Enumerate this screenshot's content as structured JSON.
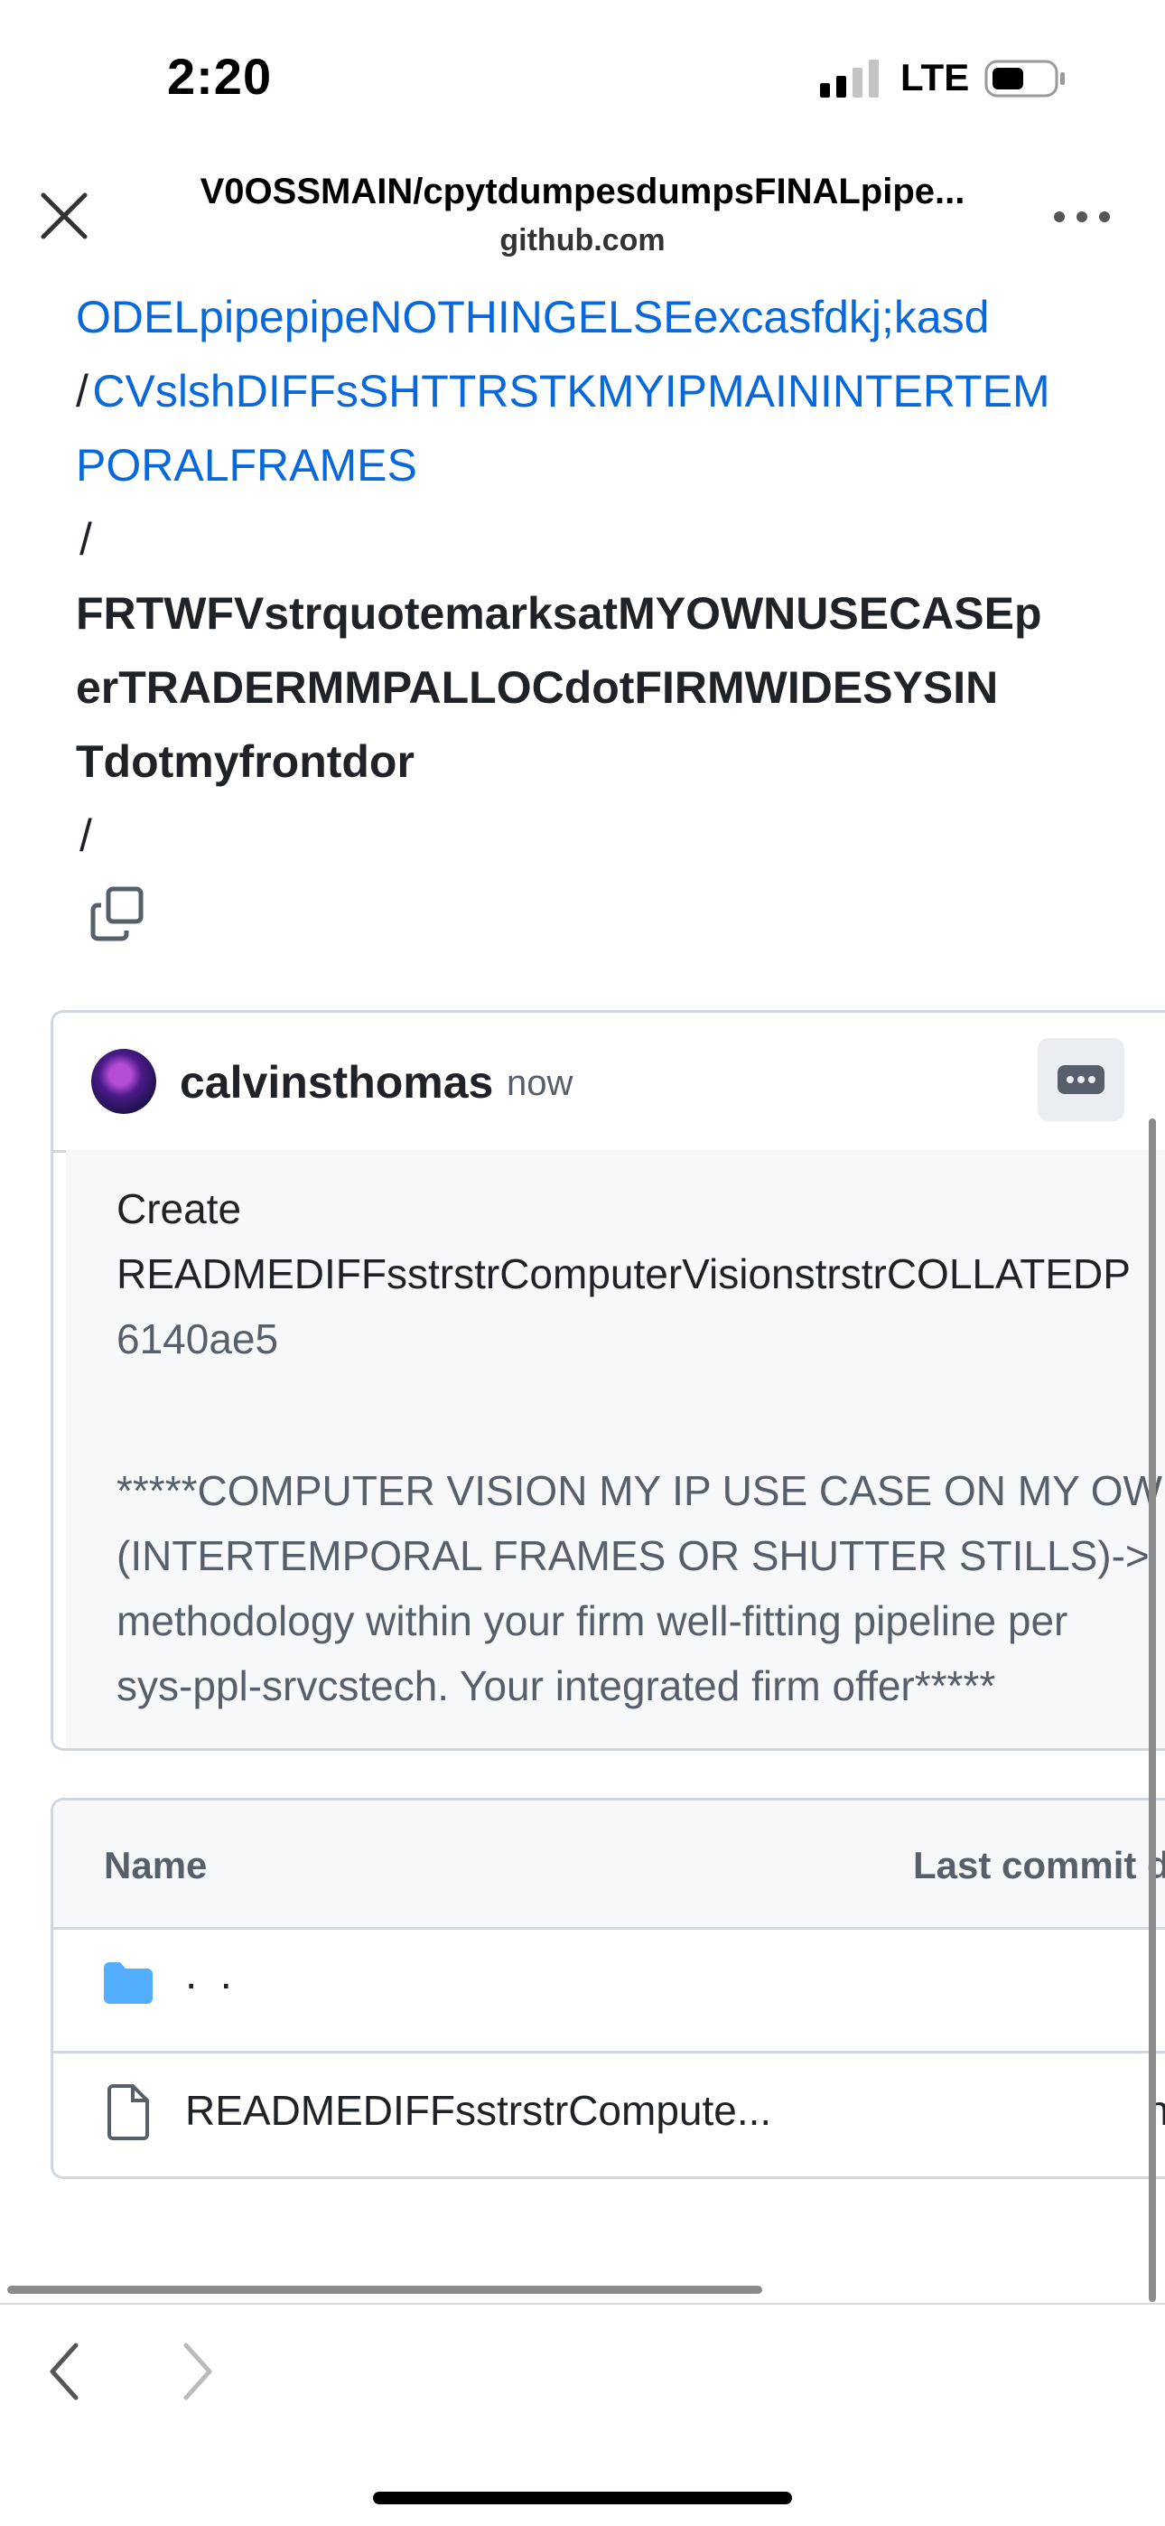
{
  "status_bar": {
    "time": "2:20",
    "network": "LTE"
  },
  "browser": {
    "title": "V0OSSMAIN/cpytdumpesdumpsFINALpipe...",
    "domain": "github.com"
  },
  "breadcrumb": {
    "line1": "ODELpipepipeNOTHINGELSEexcasfdkj;kasd",
    "sep1": "/",
    "link2_a": "CVslshDIFFsSHTTRSTKMYIPMAININTERTEM",
    "link2_b": "PORALFRAMES",
    "sep2": "/",
    "current_1": "FRTWFVstrquotemarksatMYOWNUSECASEp",
    "current_2": "erTRADERMMPALLOCdotFIRMWIDESYSIN",
    "current_3": "Tdotmyfrontdor",
    "sep3": "/"
  },
  "commit": {
    "author": "calvinsthomas",
    "time": "now",
    "message_1": "Create",
    "message_2": "READMEDIFFsstrstrComputerVisionstrstrCOLLATEDP",
    "sha": "6140ae5",
    "desc_1": "*****COMPUTER VISION MY IP USE CASE ON MY OWN",
    "desc_2": "(INTERTEMPORAL FRAMES OR SHUTTER STILLS)->",
    "desc_3": "methodology within your firm well-fitting pipeline per",
    "desc_4": "sys-ppl-srvcstech. Your integrated firm offer*****"
  },
  "file_table": {
    "col_name": "Name",
    "col_commit": "Last commit d",
    "rows": [
      {
        "name": ". .",
        "type": "folder"
      },
      {
        "name": "READMEDIFFsstrstrCompute...",
        "type": "file",
        "edge": "n"
      }
    ]
  },
  "colors": {
    "link": "#0969da",
    "border": "#d0d7de",
    "muted": "#57606a",
    "folder": "#54aeff"
  }
}
